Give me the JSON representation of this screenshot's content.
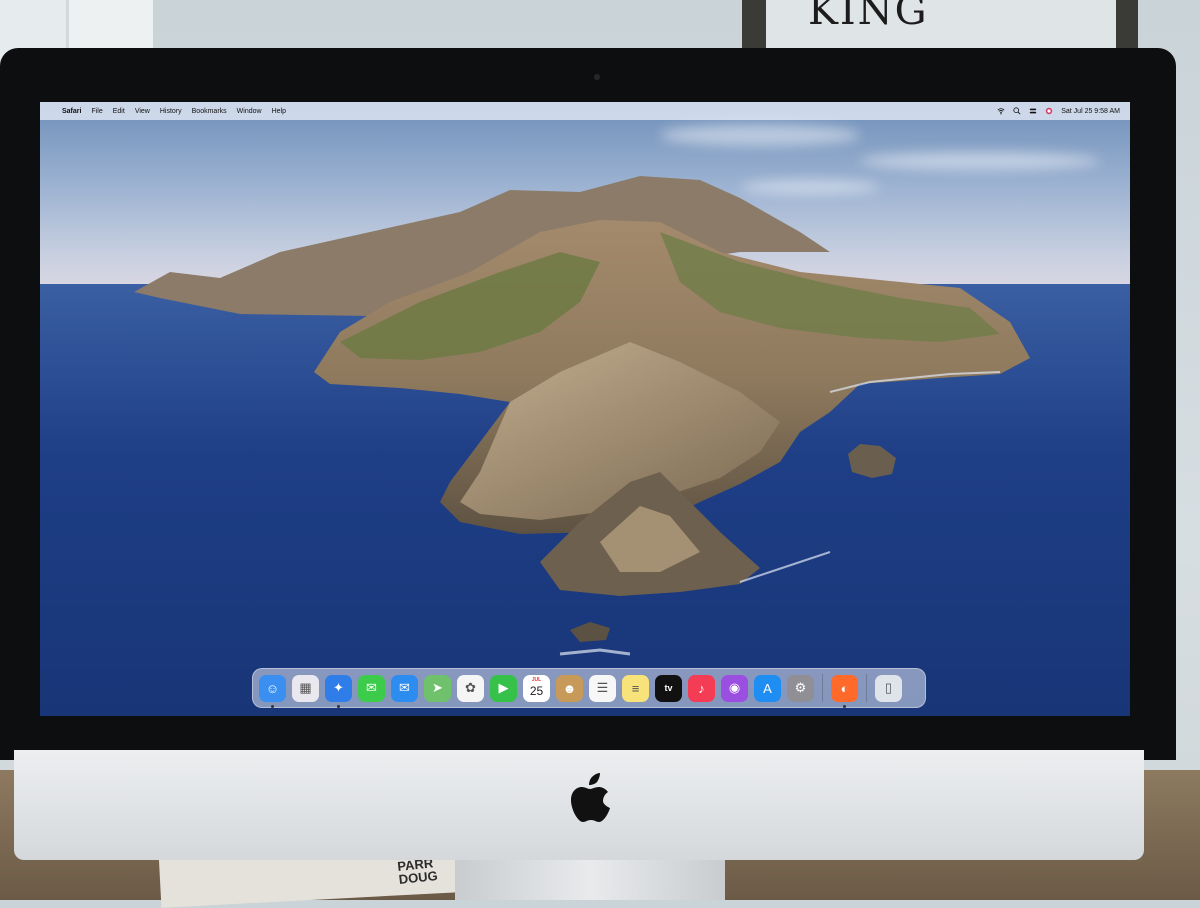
{
  "menubar": {
    "apple_symbol": "",
    "app_name": "Safari",
    "menus": [
      "File",
      "Edit",
      "View",
      "History",
      "Bookmarks",
      "Window",
      "Help"
    ],
    "clock": "Sat Jul 25  9:58 AM",
    "status_icons": [
      "wifi-icon",
      "search-icon",
      "control-center-icon",
      "siri-icon"
    ]
  },
  "dock": {
    "apps": [
      {
        "name": "Finder",
        "icon": "finder-icon",
        "color": "#3a8ff0",
        "running": true
      },
      {
        "name": "Launchpad",
        "icon": "launchpad-icon",
        "color": "#e8e8ee"
      },
      {
        "name": "Safari",
        "icon": "safari-icon",
        "color": "#2f7de8",
        "running": true
      },
      {
        "name": "Messages",
        "icon": "messages-icon",
        "color": "#3ccb4a"
      },
      {
        "name": "Mail",
        "icon": "mail-icon",
        "color": "#2d8cf0"
      },
      {
        "name": "Maps",
        "icon": "maps-icon",
        "color": "#6fc26b"
      },
      {
        "name": "Photos",
        "icon": "photos-icon",
        "color": "#f5f5f5"
      },
      {
        "name": "FaceTime",
        "icon": "facetime-icon",
        "color": "#36c24a"
      },
      {
        "name": "Calendar",
        "icon": "calendar-icon",
        "color": "#ffffff",
        "month": "JUL",
        "day": "25"
      },
      {
        "name": "Contacts",
        "icon": "contacts-icon",
        "color": "#c79a5a"
      },
      {
        "name": "Reminders",
        "icon": "reminders-icon",
        "color": "#f7f7f7"
      },
      {
        "name": "Notes",
        "icon": "notes-icon",
        "color": "#f8e27a"
      },
      {
        "name": "TV",
        "icon": "apple-tv-icon",
        "color": "#111111",
        "label": "tv"
      },
      {
        "name": "Music",
        "icon": "music-icon",
        "color": "#f43d55"
      },
      {
        "name": "Podcasts",
        "icon": "podcasts-icon",
        "color": "#9b4fe0"
      },
      {
        "name": "App Store",
        "icon": "app-store-icon",
        "color": "#1f8ef2"
      },
      {
        "name": "System Preferences",
        "icon": "gear-icon",
        "color": "#8f8f95"
      }
    ],
    "extra_apps": [
      {
        "name": "Firefox",
        "icon": "firefox-icon",
        "color": "#ff6a2a",
        "running": true
      }
    ],
    "trash": {
      "name": "Trash",
      "icon": "trash-icon",
      "color": "#dfe3ea"
    }
  },
  "background": {
    "wall_sign_text": "KING",
    "magazine_text": "PARR\nDOUG"
  }
}
